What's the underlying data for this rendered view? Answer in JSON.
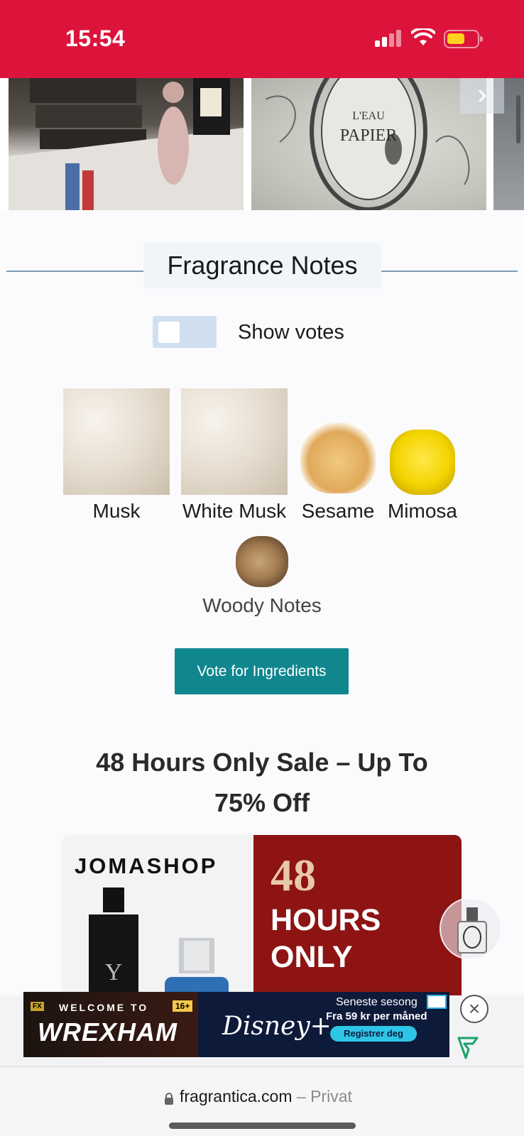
{
  "status_bar": {
    "time": "15:54"
  },
  "notes_section": {
    "title": "Fragrance Notes",
    "toggle_label": "Show votes",
    "notes": [
      {
        "name": "Musk"
      },
      {
        "name": "White Musk"
      },
      {
        "name": "Sesame"
      },
      {
        "name": "Mimosa"
      },
      {
        "name": "Woody Notes"
      }
    ],
    "vote_button": "Vote for Ingredients"
  },
  "sale": {
    "title": "48 Hours Only Sale – Up To 75% Off",
    "ad": {
      "brand": "JOMASHOP",
      "big_number": "48",
      "line1": "HOURS",
      "line2": "ONLY"
    }
  },
  "bottom_ad": {
    "badge": "FX",
    "welcome": "WELCOME TO",
    "rating": "16+",
    "show": "WREXHAM",
    "service": "Disney+",
    "line1": "Seneste sesong",
    "line2": "Fra 59 kr per måned",
    "cta": "Registrer deg"
  },
  "browser": {
    "domain": "fragrantica.com",
    "suffix": " – Privat"
  },
  "colors": {
    "status_bar": "#dc143c",
    "accent_button": "#10878f",
    "toggle": "#cfdff0",
    "section_line": "#7d9bb1"
  }
}
